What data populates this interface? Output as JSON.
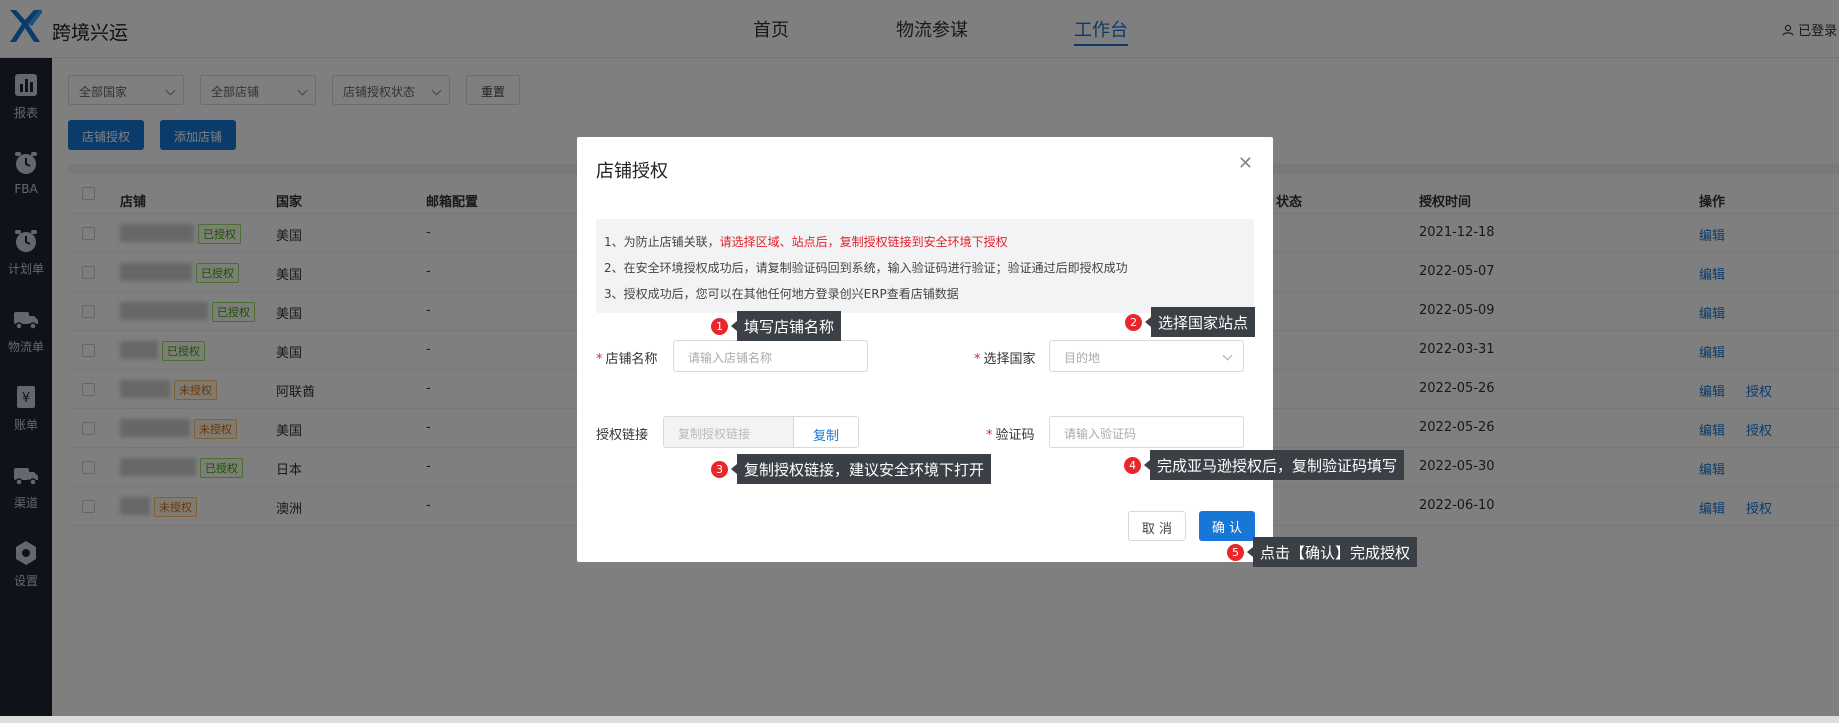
{
  "header": {
    "brand": "跨境兴运",
    "nav": [
      "首页",
      "物流参谋",
      "工作台"
    ],
    "active_nav": "工作台",
    "login": "已登录"
  },
  "sidebar": {
    "items": [
      {
        "label": "报表",
        "icon": "bar-chart-icon"
      },
      {
        "label": "FBA",
        "icon": "alarm-clock-icon"
      },
      {
        "label": "计划单",
        "icon": "alarm-clock-icon"
      },
      {
        "label": "物流单",
        "icon": "truck-icon"
      },
      {
        "label": "账单",
        "icon": "bill-icon"
      },
      {
        "label": "渠道",
        "icon": "truck-icon"
      },
      {
        "label": "设置",
        "icon": "gear-icon"
      }
    ]
  },
  "filters": {
    "country": "全部国家",
    "shop": "全部店铺",
    "auth_status": "店铺授权状态",
    "reset": "重置"
  },
  "actions": {
    "authorize": "店铺授权",
    "add_shop": "添加店铺"
  },
  "table": {
    "headers": {
      "shop": "店铺",
      "country": "国家",
      "mail": "邮箱配置",
      "status": "状态",
      "auth_time": "授权时间",
      "ops": "操作"
    },
    "rows": [
      {
        "tag": "已授权",
        "ok": true,
        "country": "美国",
        "mail": "-",
        "time": "2021-12-18",
        "ops": [
          "编辑"
        ]
      },
      {
        "tag": "已授权",
        "ok": true,
        "country": "美国",
        "mail": "-",
        "time": "2022-05-07",
        "ops": [
          "编辑"
        ]
      },
      {
        "tag": "已授权",
        "ok": true,
        "country": "美国",
        "mail": "-",
        "time": "2022-05-09",
        "ops": [
          "编辑"
        ]
      },
      {
        "tag": "已授权",
        "ok": true,
        "country": "美国",
        "mail": "-",
        "time": "2022-03-31",
        "ops": [
          "编辑"
        ]
      },
      {
        "tag": "未授权",
        "ok": false,
        "country": "阿联酋",
        "mail": "-",
        "time": "2022-05-26",
        "ops": [
          "编辑",
          "授权"
        ]
      },
      {
        "tag": "未授权",
        "ok": false,
        "country": "美国",
        "mail": "-",
        "time": "2022-05-26",
        "ops": [
          "编辑",
          "授权"
        ]
      },
      {
        "tag": "已授权",
        "ok": true,
        "country": "日本",
        "mail": "-",
        "time": "2022-05-30",
        "ops": [
          "编辑"
        ]
      },
      {
        "tag": "未授权",
        "ok": false,
        "country": "澳洲",
        "mail": "-",
        "time": "2022-06-10",
        "ops": [
          "编辑",
          "授权"
        ]
      }
    ]
  },
  "modal": {
    "title": "店铺授权",
    "notice": {
      "line1_prefix": "1、为防止店铺关联，",
      "line1_red": "请选择区域、站点后，复制授权链接到安全环境下授权",
      "line2": "2、在安全环境授权成功后，请复制验证码回到系统，输入验证码进行验证；验证通过后即授权成功",
      "line3": "3、授权成功后，您可以在其他任何地方登录创兴ERP查看店铺数据"
    },
    "shop_name_label": "店铺名称",
    "shop_name_placeholder": "请输入店铺名称",
    "country_label": "选择国家",
    "country_placeholder": "目的地",
    "link_label": "授权链接",
    "link_placeholder": "复制授权链接",
    "copy": "复制",
    "code_label": "验证码",
    "code_placeholder": "请输入验证码",
    "cancel": "取 消",
    "confirm": "确 认"
  },
  "hints": [
    {
      "num": "1",
      "text": "填写店铺名称"
    },
    {
      "num": "2",
      "text": "选择国家站点"
    },
    {
      "num": "3",
      "text": "复制授权链接，建议安全环境下打开"
    },
    {
      "num": "4",
      "text": "完成亚马逊授权后，复制验证码填写"
    },
    {
      "num": "5",
      "text": "点击【确认】完成授权"
    }
  ],
  "colors": {
    "primary": "#1677d6",
    "sidebar": "#1f2531",
    "danger": "#e0242d",
    "tooltip": "#3b3f46"
  }
}
